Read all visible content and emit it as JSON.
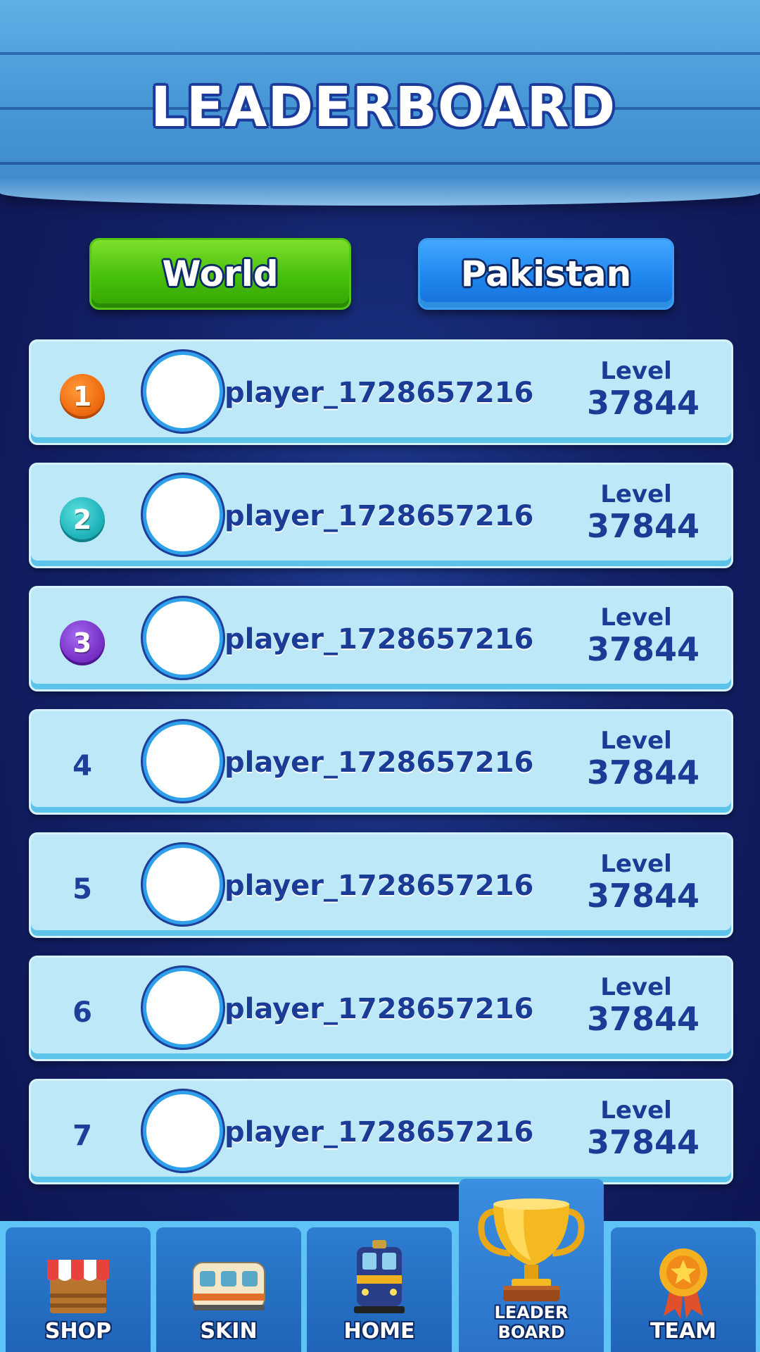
{
  "header": {
    "title": "LEADERBOARD"
  },
  "tabs": [
    {
      "label": "World",
      "active": true
    },
    {
      "label": "Pakistan",
      "active": false
    }
  ],
  "level_label": "Level",
  "players": [
    {
      "rank": "1",
      "name": "player_1728657216",
      "level": "37844"
    },
    {
      "rank": "2",
      "name": "player_1728657216",
      "level": "37844"
    },
    {
      "rank": "3",
      "name": "player_1728657216",
      "level": "37844"
    },
    {
      "rank": "4",
      "name": "player_1728657216",
      "level": "37844"
    },
    {
      "rank": "5",
      "name": "player_1728657216",
      "level": "37844"
    },
    {
      "rank": "6",
      "name": "player_1728657216",
      "level": "37844"
    },
    {
      "rank": "7",
      "name": "player_1728657216",
      "level": "37844"
    }
  ],
  "nav": [
    {
      "label": "SHOP",
      "icon": "shop-stall-icon"
    },
    {
      "label": "SKIN",
      "icon": "train-car-icon"
    },
    {
      "label": "HOME",
      "icon": "locomotive-icon"
    },
    {
      "label": "LEADER BOARD",
      "icon": "trophy-icon",
      "active": true
    },
    {
      "label": "TEAM",
      "icon": "star-medal-icon"
    }
  ],
  "colors": {
    "tab_world": "#46bf0a",
    "tab_country": "#1f86ef",
    "row_bg": "#bde8f7",
    "text_dark_blue": "#1b3c96",
    "medal_1": "#ef6c10",
    "medal_2": "#1fb4ba",
    "medal_3": "#7a32c8"
  }
}
